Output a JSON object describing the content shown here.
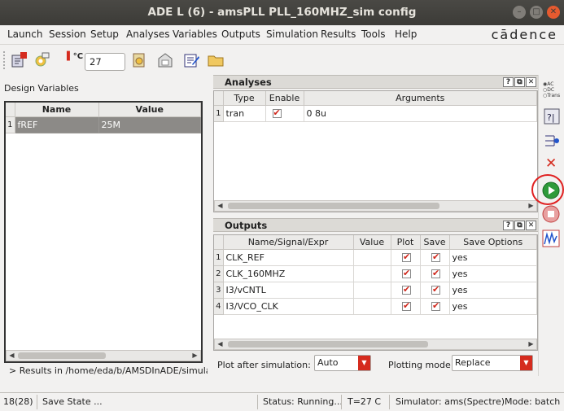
{
  "window": {
    "title": "ADE L (6) - amsPLL PLL_160MHZ_sim config"
  },
  "menubar": {
    "items": [
      {
        "label": "Launch"
      },
      {
        "label": "Session"
      },
      {
        "label": "Setup"
      },
      {
        "label": "Analyses"
      },
      {
        "label": "Variables"
      },
      {
        "label": "Outputs"
      },
      {
        "label": "Simulation"
      },
      {
        "label": "Results"
      },
      {
        "label": "Tools"
      },
      {
        "label": "Help"
      }
    ],
    "brand": "cādence"
  },
  "toolbar": {
    "temperature_unit": "°C",
    "temperature": "27"
  },
  "design_variables": {
    "title": "Design Variables",
    "columns": [
      "Name",
      "Value"
    ],
    "rows": [
      {
        "num": "1",
        "name": "fREF",
        "value": "25M"
      }
    ],
    "results_path": "> Results in /home/eda/b/AMSDInADE/simulatio"
  },
  "analyses": {
    "title": "Analyses",
    "columns": [
      "Type",
      "Enable",
      "Arguments"
    ],
    "rows": [
      {
        "num": "1",
        "type": "tran",
        "enabled": true,
        "arguments": "0 8u"
      }
    ]
  },
  "outputs": {
    "title": "Outputs",
    "columns": [
      "Name/Signal/Expr",
      "Value",
      "Plot",
      "Save",
      "Save Options"
    ],
    "rows": [
      {
        "num": "1",
        "name": "CLK_REF",
        "value": "",
        "plot": true,
        "save": true,
        "save_options": "yes"
      },
      {
        "num": "2",
        "name": "CLK_160MHZ",
        "value": "",
        "plot": true,
        "save": true,
        "save_options": "yes"
      },
      {
        "num": "3",
        "name": "I3/vCNTL",
        "value": "",
        "plot": true,
        "save": true,
        "save_options": "yes"
      },
      {
        "num": "4",
        "name": "I3/VCO_CLK",
        "value": "",
        "plot": true,
        "save": true,
        "save_options": "yes"
      }
    ],
    "plot_after_label": "Plot after simulation:",
    "plot_after_value": "Auto",
    "plotting_mode_label": "Plotting mode:",
    "plotting_mode_value": "Replace"
  },
  "side_toolbar": {
    "ac_labels": [
      "AC",
      "DC",
      "Trans"
    ]
  },
  "statusbar": {
    "counter": "18(28)",
    "save_state": "Save State ...",
    "status": "Status: Running...",
    "temp": "T=27  C",
    "simulator": "Simulator: ams(Spectre)Mode: batch"
  },
  "colors": {
    "accent": "#d52b1e",
    "run_green": "#2e9a3a",
    "highlight_circle": "#e02020"
  }
}
